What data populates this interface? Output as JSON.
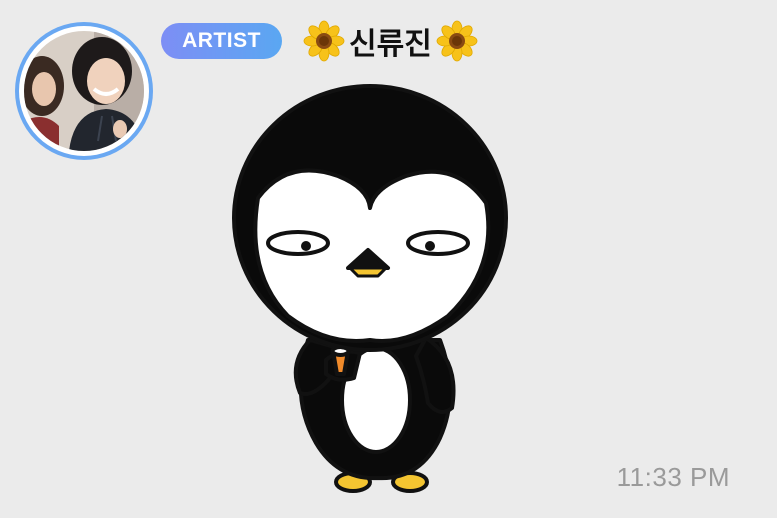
{
  "message": {
    "sender_badge": "ARTIST",
    "sender_name": "신류진",
    "sender_name_decoration": "sunflower-emoji",
    "sticker": "penguin-sticker",
    "timestamp": "11:33 PM"
  },
  "colors": {
    "background": "#ebebeb",
    "badge_gradient_start": "#7d8ef5",
    "badge_gradient_end": "#5aa7f2",
    "avatar_ring": "#6aa8f2",
    "timestamp": "#9a9a9a"
  }
}
